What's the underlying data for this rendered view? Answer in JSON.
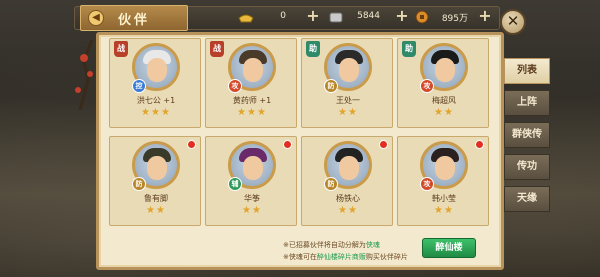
{
  "header": {
    "title": "伙伴",
    "title_icon": "back-arrow-icon",
    "resources": [
      {
        "icon": "gold-ingot-icon",
        "value": "0",
        "color": "#e8b93a"
      },
      {
        "icon": "silver-ingot-icon",
        "value": "5844",
        "color": "#c9c9c9"
      },
      {
        "icon": "coin-icon",
        "value": "895万",
        "color": "#d98c2a"
      }
    ]
  },
  "companions": [
    {
      "name": "洪七公 +1",
      "role": "战",
      "badge": "控",
      "badge_color": "#3a7bd5",
      "stars": "★★★",
      "hair_color": "#e8e8e8",
      "red_dot": false
    },
    {
      "name": "黄药师 +1",
      "role": "战",
      "badge": "攻",
      "badge_color": "#d24a2a",
      "stars": "★★★",
      "hair_color": "#4a3a2a",
      "red_dot": false
    },
    {
      "name": "王处一",
      "role": "助",
      "badge": "防",
      "badge_color": "#b8862a",
      "stars": "★★",
      "hair_color": "#2a2a2a",
      "red_dot": false
    },
    {
      "name": "梅超风",
      "role": "助",
      "badge": "攻",
      "badge_color": "#d24a2a",
      "stars": "★★",
      "hair_color": "#1a1a1a",
      "red_dot": false
    },
    {
      "name": "鲁有脚",
      "role": "",
      "badge": "防",
      "badge_color": "#b8862a",
      "stars": "★★",
      "hair_color": "#3a3a2a",
      "red_dot": true
    },
    {
      "name": "华筝",
      "role": "",
      "badge": "辅",
      "badge_color": "#2f9a5a",
      "stars": "★★",
      "hair_color": "#6a2a6a",
      "red_dot": true
    },
    {
      "name": "杨铁心",
      "role": "",
      "badge": "防",
      "badge_color": "#b8862a",
      "stars": "★★",
      "hair_color": "#222222",
      "red_dot": true
    },
    {
      "name": "韩小莹",
      "role": "",
      "badge": "攻",
      "badge_color": "#d24a2a",
      "stars": "★★",
      "hair_color": "#2a2020",
      "red_dot": true
    }
  ],
  "side_tabs": [
    "列表",
    "上阵",
    "群侠传",
    "传功",
    "天缘"
  ],
  "notes": {
    "line1_prefix": "※已招募伙伴将自动分解为",
    "line1_highlight": "侠魂",
    "line2_prefix": "※侠魂可在",
    "line2_highlight": "醉仙楼碎片商贩",
    "line2_suffix": "购买伙伴碎片"
  },
  "main_button": "醉仙楼",
  "colors": {
    "accent_green": "#1f9b4f",
    "panel": "#f3e9cf",
    "star": "#e0a52a"
  }
}
